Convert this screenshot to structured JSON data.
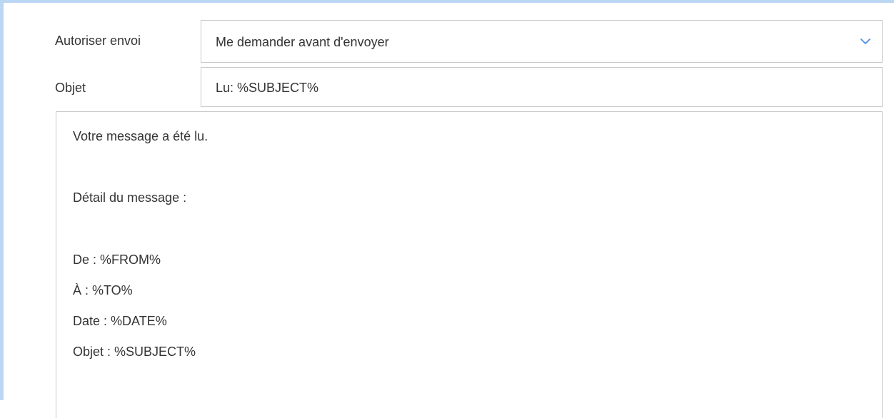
{
  "form": {
    "send_label": "Autoriser envoi",
    "send_value": "Me demander avant d'envoyer",
    "subject_label": "Objet",
    "subject_value": "Lu: %SUBJECT%"
  },
  "message_body": {
    "lines": [
      "Votre message a été lu.",
      "Détail du message :",
      "De : %FROM%",
      "À : %TO%",
      "Date : %DATE%",
      "Objet : %SUBJECT%"
    ]
  },
  "icons": {
    "dropdown": "chevron-down-icon"
  },
  "colors": {
    "frame_accent": "#bcd7f4",
    "border": "#c9c9c9",
    "text": "#333333",
    "chevron": "#4a90e2"
  }
}
